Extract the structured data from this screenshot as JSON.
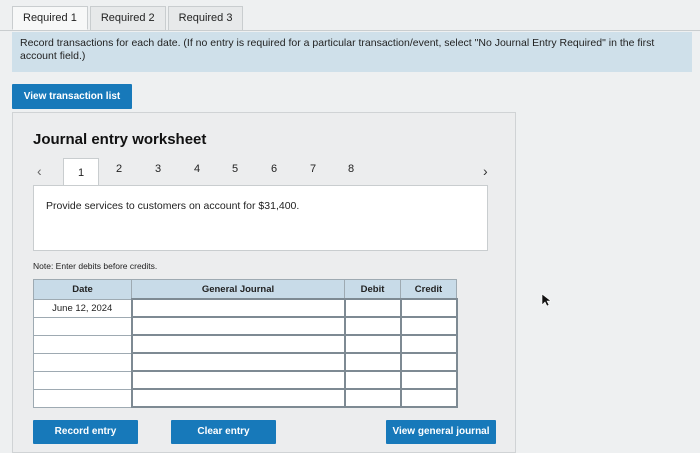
{
  "tabs": [
    "Required 1",
    "Required 2",
    "Required 3"
  ],
  "instructions": "Record transactions for each date. (If no entry is required for a particular transaction/event, select \"No Journal Entry Required\" in the first account field.)",
  "view_transaction_list": "View transaction list",
  "worksheet": {
    "title": "Journal entry worksheet",
    "pages": [
      "1",
      "2",
      "3",
      "4",
      "5",
      "6",
      "7",
      "8"
    ],
    "active_page": "1",
    "description": "Provide services to customers on account for $31,400.",
    "note": "Note: Enter debits before credits."
  },
  "table": {
    "headers": {
      "date": "Date",
      "general_journal": "General Journal",
      "debit": "Debit",
      "credit": "Credit"
    },
    "rows": [
      {
        "date": "June 12, 2024",
        "account": "",
        "debit": "",
        "credit": ""
      },
      {
        "date": "",
        "account": "",
        "debit": "",
        "credit": ""
      },
      {
        "date": "",
        "account": "",
        "debit": "",
        "credit": ""
      },
      {
        "date": "",
        "account": "",
        "debit": "",
        "credit": ""
      },
      {
        "date": "",
        "account": "",
        "debit": "",
        "credit": ""
      },
      {
        "date": "",
        "account": "",
        "debit": "",
        "credit": ""
      }
    ]
  },
  "buttons": {
    "record": "Record entry",
    "clear": "Clear entry",
    "view_general_journal": "View general journal"
  },
  "colors": {
    "accent": "#1779ba",
    "header_bg": "#c8dbe8",
    "instruction_bg": "#cfe0ea"
  }
}
